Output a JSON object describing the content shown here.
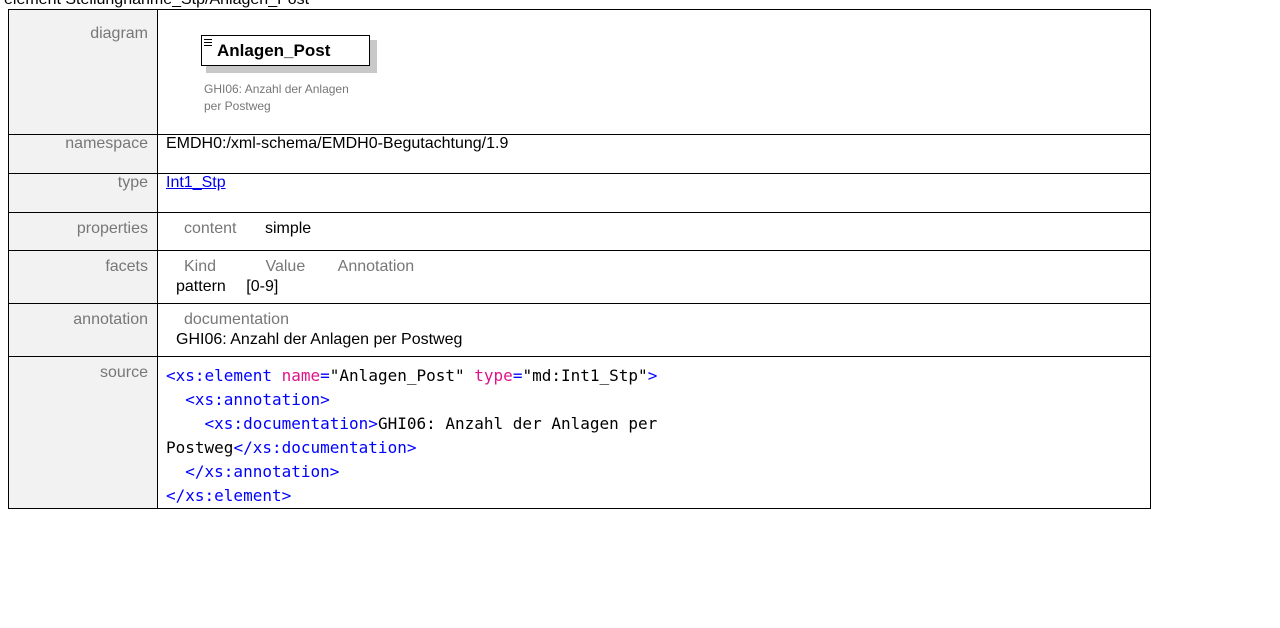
{
  "page_title": "element Stellungnahme_Stp/Anlagen_Post",
  "rows": {
    "diagram": {
      "label": "diagram",
      "element_name": "Anlagen_Post",
      "doc_line1": "GHI06: Anzahl der Anlagen",
      "doc_line2": "per Postweg"
    },
    "namespace": {
      "label": "namespace",
      "value": "EMDH0:/xml-schema/EMDH0-Begutachtung/1.9"
    },
    "type": {
      "label": "type",
      "value": "Int1_Stp"
    },
    "properties": {
      "label": "properties",
      "key": "content",
      "value": "simple"
    },
    "facets": {
      "label": "facets",
      "headers": [
        "Kind",
        "Value",
        "Annotation"
      ],
      "kind": "pattern",
      "value": "[0-9]"
    },
    "annotation": {
      "label": "annotation",
      "heading": "documentation",
      "text": "GHI06: Anzahl der Anlagen per Postweg"
    },
    "source": {
      "label": "source",
      "lines": [
        "<xs:element name=\"Anlagen_Post\" type=\"md:Int1_Stp\">",
        "  <xs:annotation>",
        "    <xs:documentation>GHI06: Anzahl der Anlagen per",
        "Postweg</xs:documentation>",
        "  </xs:annotation>",
        "</xs:element>"
      ]
    }
  }
}
